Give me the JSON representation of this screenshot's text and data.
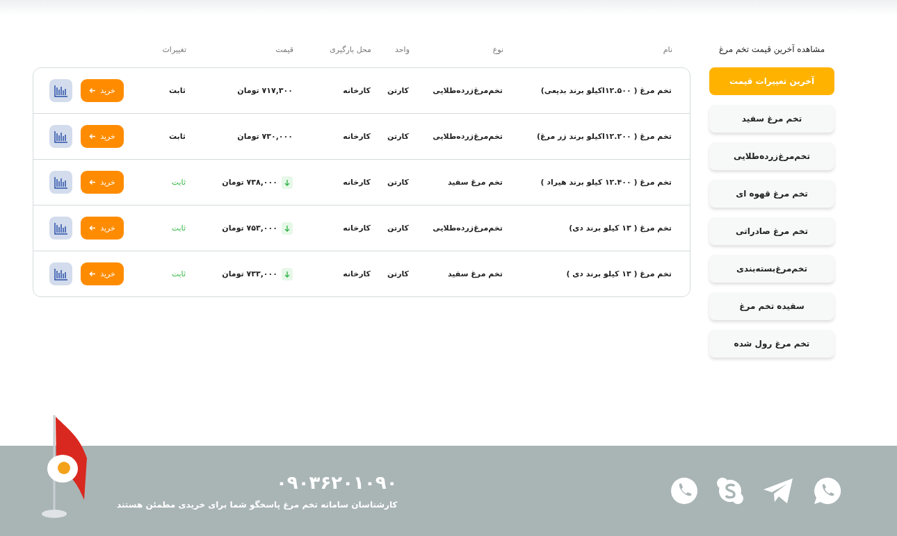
{
  "sidebar": {
    "title": "مشاهده آخرین قیمت تخم مرغ",
    "items": [
      {
        "label": "آخرین تغییرات قیمت",
        "selected": true
      },
      {
        "label": "تخم مرغ سفید",
        "selected": false
      },
      {
        "label": "تخم‌مرغ‌زرده‌طلایی",
        "selected": false
      },
      {
        "label": "تخم مرغ قهوه ای",
        "selected": false
      },
      {
        "label": "تخم مرغ صادراتی",
        "selected": false
      },
      {
        "label": "تخم‌مرغ‌بسته‌بندی",
        "selected": false
      },
      {
        "label": "سفیده تخم مرغ",
        "selected": false
      },
      {
        "label": "تخم مرغ رول شده",
        "selected": false
      }
    ]
  },
  "table": {
    "columns": [
      "نام",
      "نوع",
      "واحد",
      "محل بارگیری",
      "قیمت",
      "تغییرات"
    ],
    "rows": [
      {
        "name": "تخم مرغ ( ۱۲.۵۰۰اکیلو برند بدیعی)",
        "type": "تخم‌مرغ‌زرده‌طلایی",
        "unit": "کارتن",
        "place": "کارخانه",
        "price": "۷۱۷,۳۰۰ تومان",
        "falling": false,
        "change": "ثابت",
        "buy": "خرید"
      },
      {
        "name": "تخم مرغ ( ۱۲.۲۰۰اکیلو برند زر مرغ)",
        "type": "تخم‌مرغ‌زرده‌طلایی",
        "unit": "کارتن",
        "place": "کارخانه",
        "price": "۷۳۰,۰۰۰ تومان",
        "falling": false,
        "change": "ثابت",
        "buy": "خرید"
      },
      {
        "name": "تخم مرغ ( ۱۲.۴۰۰ کیلو برند هیراد )",
        "type": "تخم مرغ سفید",
        "unit": "کارتن",
        "place": "کارخانه",
        "price": "۷۳۸,۰۰۰ تومان",
        "falling": true,
        "change": "ثابت",
        "buy": "خرید"
      },
      {
        "name": "تخم مرغ ( ۱۳ کیلو برند دی)",
        "type": "تخم‌مرغ‌زرده‌طلایی",
        "unit": "کارتن",
        "place": "کارخانه",
        "price": "۷۵۳,۰۰۰ تومان",
        "falling": true,
        "change": "ثابت",
        "buy": "خرید"
      },
      {
        "name": "تخم مرغ ( ۱۳ کیلو برند دی )",
        "type": "تخم مرغ سفید",
        "unit": "کارتن",
        "place": "کارخانه",
        "price": "۷۳۳,۰۰۰ تومان",
        "falling": true,
        "change": "ثابت",
        "buy": "خرید"
      }
    ]
  },
  "footer": {
    "phone": "۰۹۰۳۶۲۰۱۰۹۰",
    "tagline": "کارشناسان سامانه تخم مرغ پاسخگو شما برای خریدی مطمئن هستند"
  }
}
